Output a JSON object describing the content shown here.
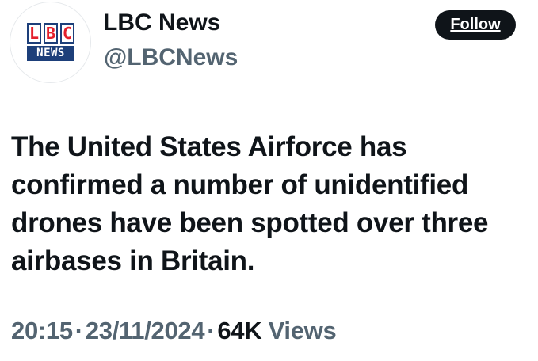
{
  "account": {
    "name": "LBC News",
    "handle": "@LBCNews",
    "avatar": {
      "logo_letters": [
        "L",
        "B",
        "C"
      ],
      "logo_subtext": "NEWS",
      "colors": {
        "letter": "#e4202c",
        "frame": "#1d3f7a",
        "subtext_bg": "#1d3f7a",
        "subtext_fg": "#ffffff"
      }
    }
  },
  "follow_button": {
    "label": "Follow"
  },
  "tweet": {
    "text": "The United States Airforce has confirmed a number of unidentified drones have been spotted over three airbases in Britain."
  },
  "meta": {
    "time": "20:15",
    "separator": "·",
    "date": "23/11/2024",
    "views_count": "64K",
    "views_label": "Views"
  },
  "colors": {
    "primary_text": "#0f1419",
    "secondary_text": "#536471",
    "background": "#ffffff",
    "follow_button_bg": "#0f1419"
  }
}
